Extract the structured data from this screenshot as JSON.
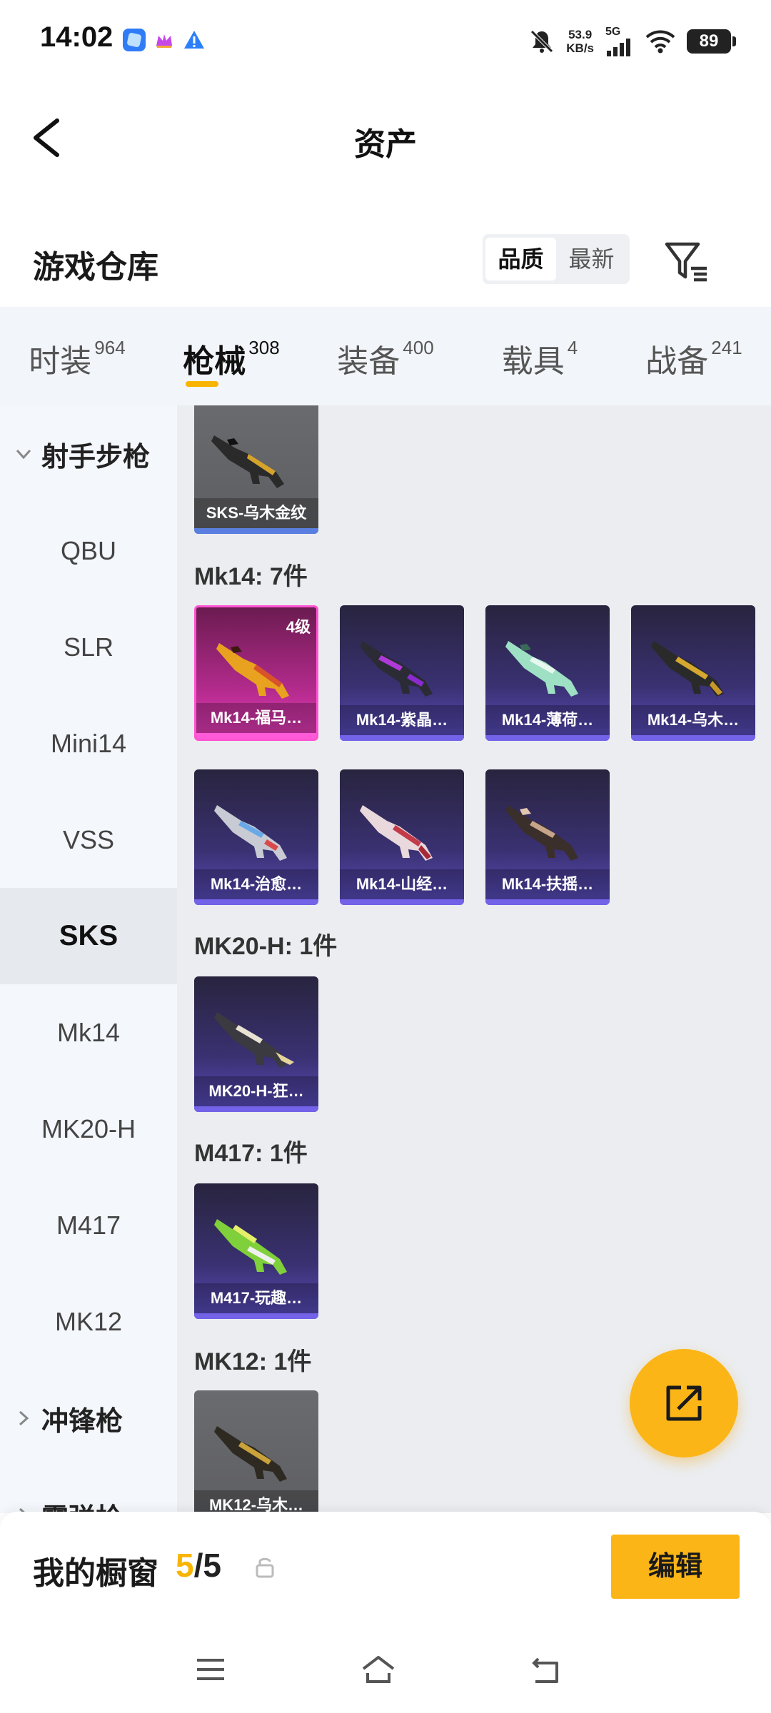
{
  "status_bar": {
    "time": "14:02",
    "net_speed_value": "53.9",
    "net_speed_unit": "KB/s",
    "network": "5G",
    "battery": "89",
    "icons": [
      "blue-app-icon",
      "crown-app-icon",
      "warning-icon",
      "mute-icon",
      "signal-icon",
      "wifi-icon"
    ]
  },
  "header": {
    "title": "资产"
  },
  "warehouse": {
    "title": "游戏仓库",
    "sort_options": [
      "品质",
      "最新"
    ],
    "active_sort": "品质"
  },
  "tabs": [
    {
      "name": "时装",
      "count": "964"
    },
    {
      "name": "枪械",
      "count": "308",
      "active": true
    },
    {
      "name": "装备",
      "count": "400"
    },
    {
      "name": "载具",
      "count": "4"
    },
    {
      "name": "战备",
      "count": "241"
    }
  ],
  "sidebar": {
    "groups": {
      "marksman": "射手步枪",
      "smg": "冲锋枪",
      "shotgun": "霰弹枪"
    },
    "items": [
      "QBU",
      "SLR",
      "Mini14",
      "VSS",
      "SKS",
      "Mk14",
      "MK20-H",
      "M417",
      "MK12"
    ],
    "active_item": "SKS"
  },
  "content": {
    "sks_card": "SKS-乌木金纹",
    "groups": {
      "mk14": {
        "title": "Mk14: 7件",
        "items": [
          "Mk14-福马…",
          "Mk14-紫晶…",
          "Mk14-薄荷…",
          "Mk14-乌木…",
          "Mk14-治愈…",
          "Mk14-山经…",
          "Mk14-扶摇…"
        ],
        "level_badge": "4级"
      },
      "mk20h": {
        "title": "MK20-H: 1件",
        "items": [
          "MK20-H-狂…"
        ]
      },
      "m417": {
        "title": "M417: 1件",
        "items": [
          "M417-玩趣…"
        ]
      },
      "mk12": {
        "title": "MK12: 1件",
        "items": [
          "MK12-乌木…"
        ]
      }
    }
  },
  "showcase": {
    "title": "我的橱窗",
    "current": "5",
    "separator": "/",
    "total": "5",
    "edit_label": "编辑"
  },
  "colors": {
    "accent": "#f8b400",
    "card_purple": "#3a3172",
    "card_pink": "#e43bb8",
    "card_gray": "#5d5e62"
  }
}
